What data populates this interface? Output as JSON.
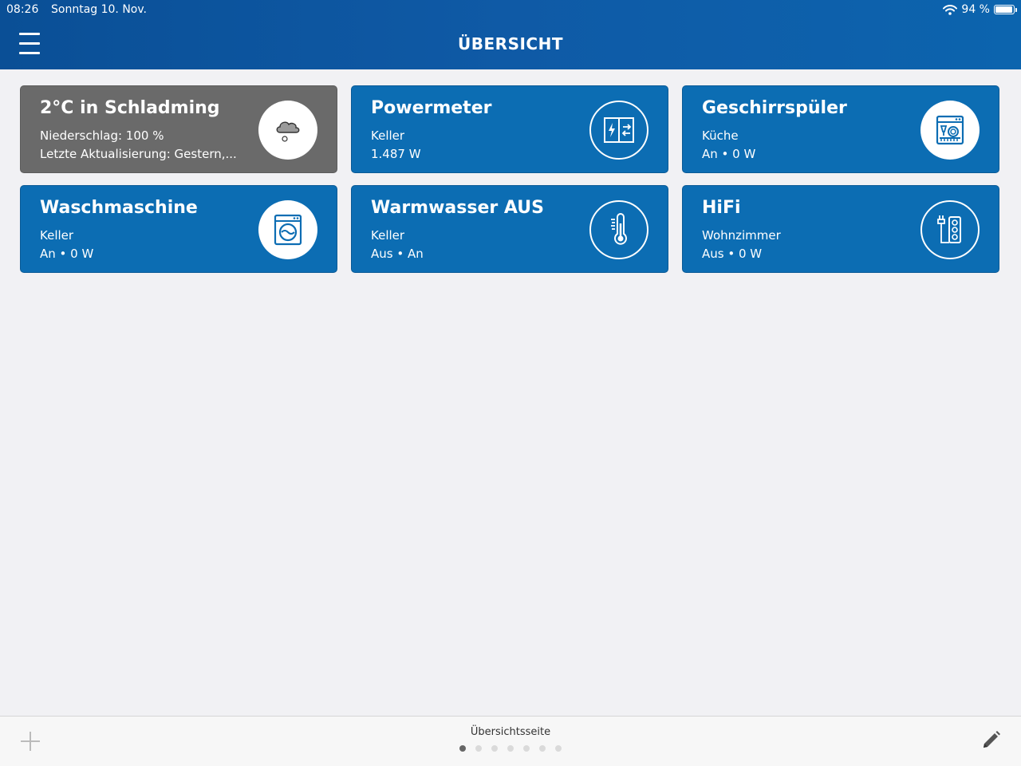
{
  "status_bar": {
    "time": "08:26",
    "date": "Sonntag 10. Nov.",
    "battery": "94 %",
    "battery_level": 0.94
  },
  "header": {
    "title": "ÜBERSICHT",
    "menu_icon": "hamburger-menu-icon"
  },
  "tiles": [
    {
      "title": "2°C in Schladming",
      "line1": "Niederschlag: 100 %",
      "line2": "Letzte Aktualisierung: Gestern,...",
      "icon": "weather-cloud-rain-icon",
      "color": "#6a6a6a"
    },
    {
      "title": "Powermeter",
      "line1": "Keller",
      "line2": "1.487 W",
      "icon": "power-meter-icon",
      "color": "#0c6db3"
    },
    {
      "title": "Geschirrspüler",
      "line1": "Küche",
      "line2": "An • 0 W",
      "icon": "dishwasher-icon",
      "color": "#0c6db3"
    },
    {
      "title": "Waschmaschine",
      "line1": "Keller",
      "line2": "An • 0 W",
      "icon": "washing-machine-icon",
      "color": "#0c6db3"
    },
    {
      "title": "Warmwasser AUS",
      "line1": "Keller",
      "line2": "Aus • An",
      "icon": "thermometer-icon",
      "color": "#0c6db3"
    },
    {
      "title": "HiFi",
      "line1": "Wohnzimmer",
      "line2": "Aus • 0 W",
      "icon": "power-strip-icon",
      "color": "#0c6db3"
    }
  ],
  "bottom_bar": {
    "page_label": "Übersichtsseite",
    "page_count": 7,
    "active_page": 1,
    "add_icon": "plus-icon",
    "edit_icon": "pencil-icon"
  },
  "colors": {
    "accent": "#0c6db3",
    "header": "#0f5aa6",
    "background": "#f1f1f4"
  }
}
